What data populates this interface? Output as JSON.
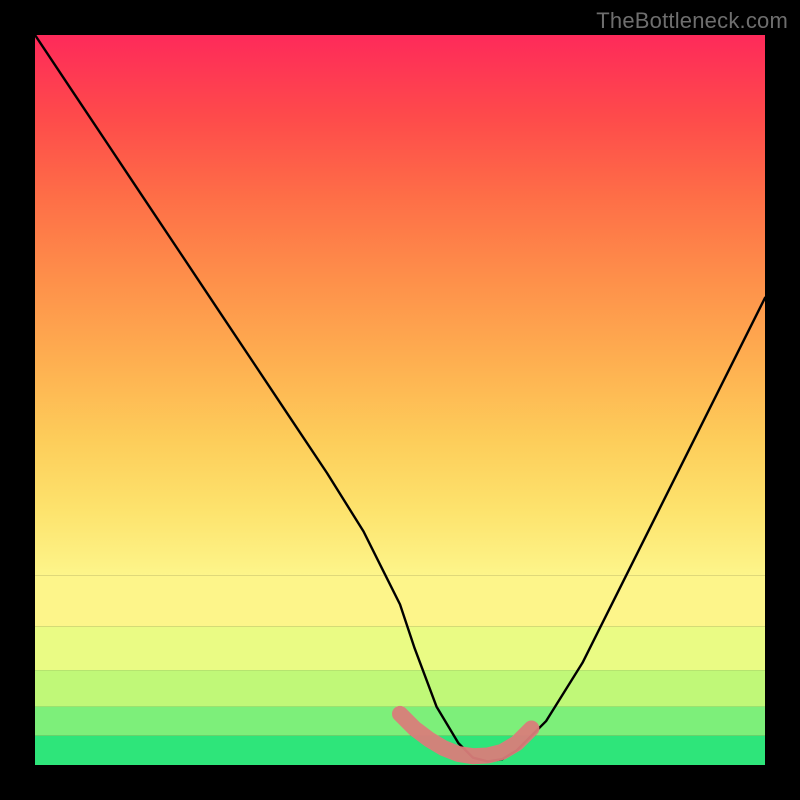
{
  "watermark": "TheBottleneck.com",
  "chart_data": {
    "type": "line",
    "title": "",
    "xlabel": "",
    "ylabel": "",
    "xlim": [
      0,
      100
    ],
    "ylim": [
      0,
      100
    ],
    "curve": {
      "name": "bottleneck-curve",
      "color": "#000000",
      "x": [
        0,
        5,
        10,
        15,
        20,
        25,
        30,
        35,
        40,
        45,
        50,
        52,
        55,
        58,
        60,
        62,
        64,
        66,
        70,
        75,
        80,
        85,
        90,
        95,
        100
      ],
      "y": [
        100,
        92.5,
        85,
        77.5,
        70,
        62.5,
        55,
        47.5,
        40,
        32,
        22,
        16,
        8,
        3,
        1,
        0.5,
        0.8,
        2,
        6,
        14,
        24,
        34,
        44,
        54,
        64
      ]
    },
    "trough_marker": {
      "name": "optimal-range-marker",
      "color": "#d97d7a",
      "x": [
        50,
        52,
        54,
        56,
        58,
        60,
        62,
        64,
        66,
        68
      ],
      "y": [
        7,
        5,
        3.5,
        2.3,
        1.5,
        1.2,
        1.3,
        1.8,
        3,
        5
      ]
    },
    "background_bands": [
      {
        "y0": 0,
        "y1": 4,
        "color": "#2ee57a"
      },
      {
        "y0": 4,
        "y1": 8,
        "color": "#7def7a"
      },
      {
        "y0": 8,
        "y1": 13,
        "color": "#c0f878"
      },
      {
        "y0": 13,
        "y1": 19,
        "color": "#eafb84"
      },
      {
        "y0": 19,
        "y1": 26,
        "color": "#fdf58a"
      }
    ],
    "background_gradient": {
      "y0": 26,
      "y1": 100,
      "stops": [
        {
          "offset": 0.0,
          "color": "#fdf58a"
        },
        {
          "offset": 0.12,
          "color": "#fde36d"
        },
        {
          "offset": 0.25,
          "color": "#fdcd5a"
        },
        {
          "offset": 0.4,
          "color": "#feae50"
        },
        {
          "offset": 0.55,
          "color": "#fe8f4a"
        },
        {
          "offset": 0.7,
          "color": "#fe6e47"
        },
        {
          "offset": 0.85,
          "color": "#fe4a4b"
        },
        {
          "offset": 1.0,
          "color": "#fe2a5a"
        }
      ]
    }
  }
}
